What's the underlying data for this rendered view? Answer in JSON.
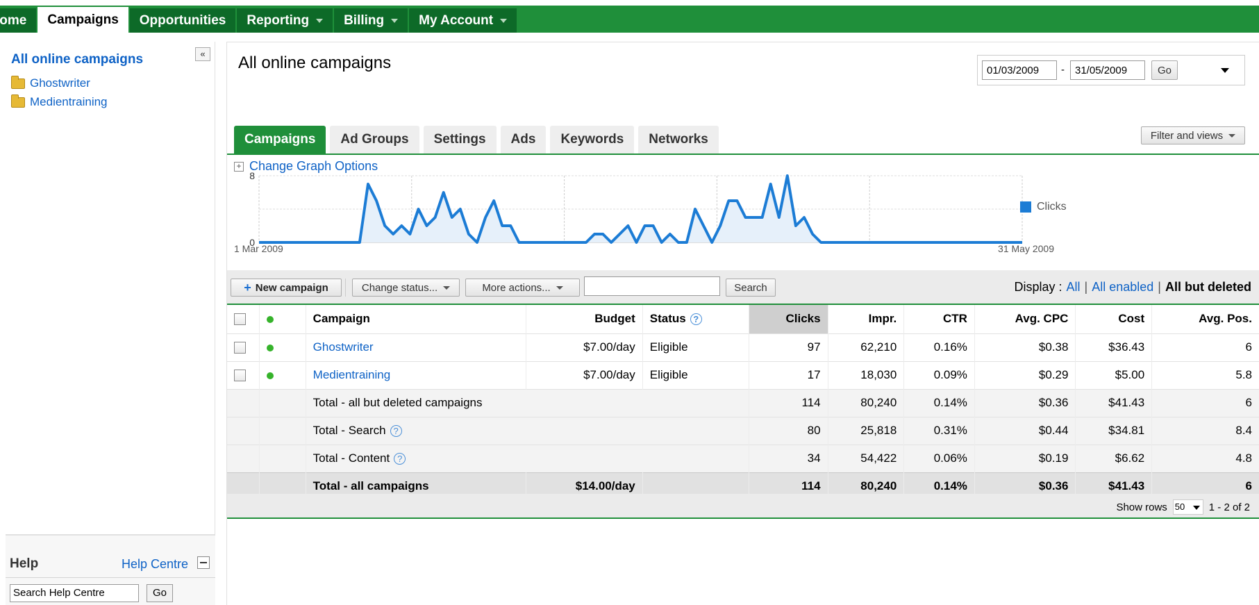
{
  "nav": {
    "items": [
      {
        "label": "Home",
        "display": "lome",
        "active": false
      },
      {
        "label": "Campaigns",
        "active": true
      },
      {
        "label": "Opportunities",
        "active": false
      },
      {
        "label": "Reporting",
        "active": false,
        "dropdown": true
      },
      {
        "label": "Billing",
        "active": false,
        "dropdown": true
      },
      {
        "label": "My Account",
        "active": false,
        "dropdown": true
      }
    ]
  },
  "sidebar": {
    "title": "All online campaigns",
    "collapse": "«",
    "items": [
      {
        "label": "Ghostwriter",
        "icon": "folder-icon"
      },
      {
        "label": "Medientraining",
        "icon": "folder-icon"
      }
    ]
  },
  "help": {
    "title": "Help",
    "centre_link": "Help Centre",
    "search_placeholder": "Search Help Centre",
    "go": "Go"
  },
  "main": {
    "title": "All online campaigns",
    "date_from": "01/03/2009",
    "date_sep": "-",
    "date_to": "31/05/2009",
    "date_go": "Go",
    "filter_button": "Filter and views",
    "tabs": [
      "Campaigns",
      "Ad Groups",
      "Settings",
      "Ads",
      "Keywords",
      "Networks"
    ],
    "graph_options": "Change Graph Options",
    "toolbar": {
      "new_campaign": "New campaign",
      "change_status": "Change status...",
      "more_actions": "More actions...",
      "search_value": "",
      "search_button": "Search",
      "display_label": "Display :",
      "display_all": "All",
      "display_all_enabled": "All enabled",
      "display_current": "All but deleted"
    },
    "footer": {
      "show_rows_label": "Show rows",
      "rows_value": "50",
      "range": "1 - 2 of 2"
    }
  },
  "table": {
    "headers": {
      "campaign": "Campaign",
      "budget": "Budget",
      "status": "Status",
      "clicks": "Clicks",
      "impr": "Impr.",
      "ctr": "CTR",
      "cpc": "Avg. CPC",
      "cost": "Cost",
      "pos": "Avg. Pos."
    },
    "rows": [
      {
        "campaign": "Ghostwriter",
        "budget": "$7.00/day",
        "status": "Eligible",
        "clicks": "97",
        "impr": "62,210",
        "ctr": "0.16%",
        "cpc": "$0.38",
        "cost": "$36.43",
        "pos": "6"
      },
      {
        "campaign": "Medientraining",
        "budget": "$7.00/day",
        "status": "Eligible",
        "clicks": "17",
        "impr": "18,030",
        "ctr": "0.09%",
        "cpc": "$0.29",
        "cost": "$5.00",
        "pos": "5.8"
      }
    ],
    "totals": [
      {
        "label": "Total - all but deleted campaigns",
        "help": false,
        "clicks": "114",
        "impr": "80,240",
        "ctr": "0.14%",
        "cpc": "$0.36",
        "cost": "$41.43",
        "pos": "6"
      },
      {
        "label": "Total - Search",
        "help": true,
        "clicks": "80",
        "impr": "25,818",
        "ctr": "0.31%",
        "cpc": "$0.44",
        "cost": "$34.81",
        "pos": "8.4"
      },
      {
        "label": "Total - Content",
        "help": true,
        "clicks": "34",
        "impr": "54,422",
        "ctr": "0.06%",
        "cpc": "$0.19",
        "cost": "$6.62",
        "pos": "4.8"
      }
    ],
    "grand_total": {
      "label": "Total - all campaigns",
      "budget": "$14.00/day",
      "clicks": "114",
      "impr": "80,240",
      "ctr": "0.14%",
      "cpc": "$0.36",
      "cost": "$41.43",
      "pos": "6"
    }
  },
  "chart_data": {
    "type": "line",
    "x_start_label": "1 Mar 2009",
    "x_end_label": "31 May 2009",
    "ylim": [
      0,
      8
    ],
    "y_ticks": [
      "0",
      "8"
    ],
    "series": [
      {
        "name": "Clicks",
        "color": "#1c7cd5",
        "values": [
          0,
          0,
          0,
          0,
          0,
          0,
          0,
          0,
          0,
          0,
          0,
          0,
          0,
          7,
          5,
          2,
          1,
          2,
          1,
          4,
          2,
          3,
          6,
          3,
          4,
          1,
          0,
          3,
          5,
          2,
          2,
          0,
          0,
          0,
          0,
          0,
          0,
          0,
          0,
          0,
          1,
          1,
          0,
          1,
          2,
          0,
          2,
          2,
          0,
          1,
          0,
          0,
          4,
          2,
          0,
          2,
          5,
          5,
          3,
          3,
          3,
          7,
          3,
          8,
          2,
          3,
          1,
          0,
          0,
          0,
          0,
          0,
          0,
          0,
          0,
          0,
          0,
          0,
          0,
          0,
          0,
          0,
          0,
          0,
          0,
          0,
          0,
          0,
          0,
          0,
          0,
          0
        ]
      }
    ]
  }
}
